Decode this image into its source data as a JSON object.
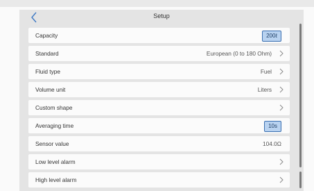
{
  "header": {
    "title": "Setup",
    "back_icon": "chevron-left-icon"
  },
  "rows": [
    {
      "label": "Capacity",
      "value": "200ℓ",
      "kind": "badge"
    },
    {
      "label": "Standard",
      "value": "European (0 to 180 Ohm)",
      "kind": "chevron"
    },
    {
      "label": "Fluid type",
      "value": "Fuel",
      "kind": "chevron"
    },
    {
      "label": "Volume unit",
      "value": "Liters",
      "kind": "chevron"
    },
    {
      "label": "Custom shape",
      "value": "",
      "kind": "chevron"
    },
    {
      "label": "Averaging time",
      "value": "10s",
      "kind": "badge"
    },
    {
      "label": "Sensor value",
      "value": "104.0Ω",
      "kind": "text"
    },
    {
      "label": "Low level alarm",
      "value": "",
      "kind": "chevron"
    },
    {
      "label": "High level alarm",
      "value": "",
      "kind": "chevron"
    }
  ],
  "colors": {
    "accent": "#3d78c4",
    "badge_bg": "#b8d2f0",
    "badge_border": "#3a6fb0",
    "panel_bg": "#e4e4e4",
    "row_bg": "#fbfbfb"
  }
}
